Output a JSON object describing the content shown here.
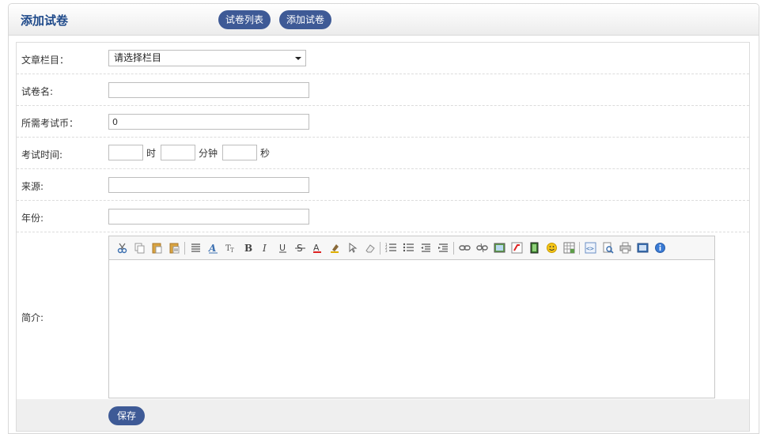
{
  "header": {
    "title": "添加试卷",
    "list_button": "试卷列表",
    "add_button": "添加试卷"
  },
  "form": {
    "category": {
      "label": "文章栏目：",
      "selected": "请选择栏目"
    },
    "name": {
      "label": "试卷名:",
      "value": ""
    },
    "coins": {
      "label": "所需考试币：",
      "value": "0"
    },
    "exam_time": {
      "label": "考试时间:",
      "hour_unit": "时",
      "minute_unit": "分钟",
      "second_unit": "秒"
    },
    "source": {
      "label": "来源:",
      "value": ""
    },
    "year": {
      "label": "年份:",
      "value": ""
    },
    "intro": {
      "label": "简介:"
    }
  },
  "toolbar_icons": [
    "cut-icon",
    "copy-icon",
    "paste-icon",
    "paste-text-icon",
    "align-icon",
    "font-name-icon",
    "font-size-icon",
    "bold-icon",
    "italic-icon",
    "underline-icon",
    "strikethrough-icon",
    "text-color-icon",
    "highlight-icon",
    "select-all-icon",
    "remove-format-icon",
    "ordered-list-icon",
    "unordered-list-icon",
    "outdent-icon",
    "indent-icon",
    "link-icon",
    "unlink-icon",
    "image-icon",
    "flash-icon",
    "media-icon",
    "emoticon-icon",
    "table-icon",
    "source-icon",
    "preview-icon",
    "print-icon",
    "fullscreen-icon",
    "about-icon"
  ],
  "footer": {
    "save_label": "保存"
  },
  "colors": {
    "accent": "#3e5a96",
    "title": "#1f4a8a"
  }
}
